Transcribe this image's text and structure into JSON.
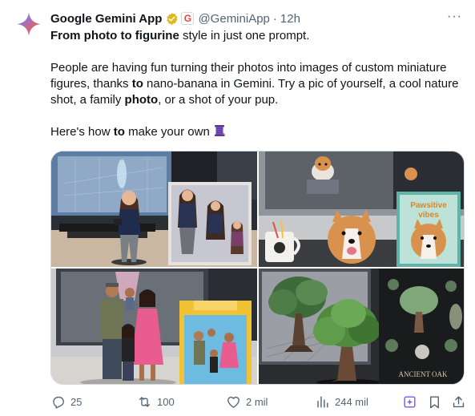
{
  "author": {
    "display_name": "Google Gemini App",
    "handle": "@GeminiApp",
    "separator": "·",
    "time": "12h",
    "badge_letter": "G"
  },
  "more_label": "···",
  "tweet": {
    "line1": {
      "b1": "From photo to figurine",
      "t1": " style in just one prompt."
    },
    "para2": {
      "t1": "People are having fun turning their photos into images of custom miniature figures, thanks ",
      "b1": "to",
      "t2": " nano-banana in Gemini. Try a pic of yourself, a cool nature shot, a family ",
      "b2": "photo",
      "t3": ", or a shot of your pup."
    },
    "para3": {
      "t1": "Here's how ",
      "b1": "to",
      "t2": " make your own "
    }
  },
  "media": {
    "images": [
      {
        "subject": "woman figurine on desk with box"
      },
      {
        "subject": "corgi figurine with box and mug"
      },
      {
        "subject": "family figurine with box"
      },
      {
        "subject": "tree figurine with box"
      }
    ],
    "box_text_corgi": "Pawsitive vibes",
    "box_text_tree": "ANCIENT OAK"
  },
  "actions": {
    "replies": "25",
    "reposts": "100",
    "likes": "2 mil",
    "views": "244 mil"
  },
  "colors": {
    "text": "#0f1419",
    "secondary": "#536471",
    "verified_gold": "#e2b719",
    "border": "#cfd9de"
  },
  "icons": [
    "gemini-sparkle-icon",
    "verified-badge-icon",
    "google-g-badge-icon",
    "reply-icon",
    "repost-icon",
    "like-icon",
    "views-icon",
    "grok-icon",
    "bookmark-icon",
    "share-icon",
    "thread-spool-icon"
  ]
}
